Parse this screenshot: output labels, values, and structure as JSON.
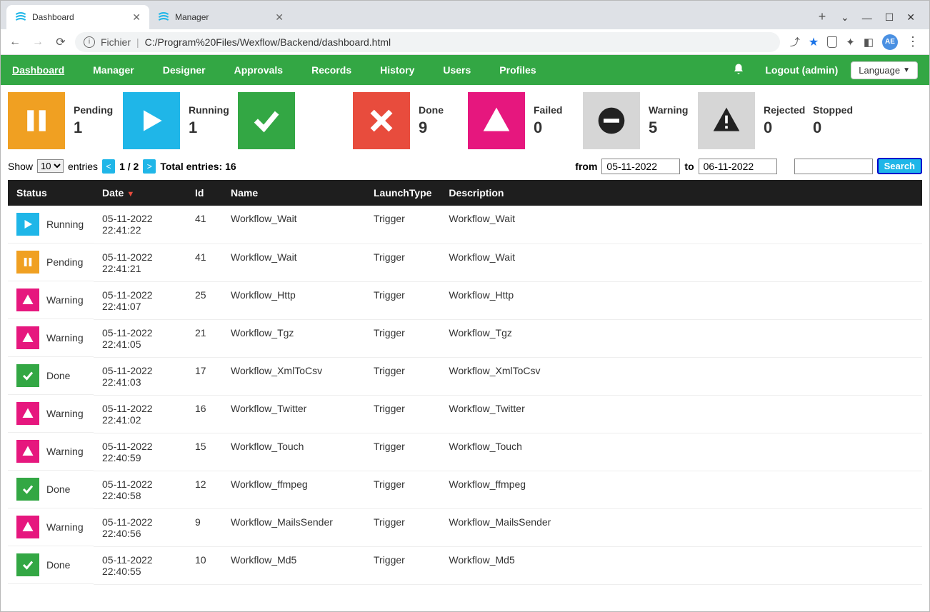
{
  "browser": {
    "tabs": [
      {
        "title": "Dashboard",
        "active": true
      },
      {
        "title": "Manager",
        "active": false
      }
    ],
    "addr": {
      "label": "Fichier",
      "url": "C:/Program%20Files/Wexflow/Backend/dashboard.html"
    },
    "avatar": "AE"
  },
  "nav": {
    "items": [
      "Dashboard",
      "Manager",
      "Designer",
      "Approvals",
      "Records",
      "History",
      "Users",
      "Profiles"
    ],
    "active": "Dashboard",
    "logout": "Logout (admin)",
    "language": "Language"
  },
  "tiles": [
    {
      "label": "Pending",
      "count": "1",
      "color": "c-orange",
      "icon": "pause"
    },
    {
      "label": "Running",
      "count": "1",
      "color": "c-blue",
      "icon": "play"
    },
    {
      "label": "",
      "count": "",
      "color": "c-green",
      "icon": "check"
    },
    {
      "label": "Done",
      "count": "9",
      "color": "c-red",
      "icon": "times"
    },
    {
      "label": "Failed",
      "count": "0",
      "color": "c-pink",
      "icon": "warn"
    },
    {
      "label": "Warning",
      "count": "5",
      "color": "c-grey",
      "icon": "minus"
    },
    {
      "label": "Rejected",
      "count": "0",
      "color": "c-grey",
      "icon": "excl"
    },
    {
      "label": "Stopped",
      "count": "0",
      "color": "",
      "icon": ""
    }
  ],
  "controls": {
    "show": "Show",
    "pagesize": "10",
    "entries": "entries",
    "page": "1 / 2",
    "total": "Total entries: 16",
    "from": "from",
    "from_val": "05-11-2022",
    "to": "to",
    "to_val": "06-11-2022",
    "search": "Search"
  },
  "table": {
    "headers": [
      "Status",
      "Date",
      "Id",
      "Name",
      "LaunchType",
      "Description"
    ],
    "rows": [
      {
        "status": "Running",
        "icon": "play",
        "color": "c-blue",
        "date": "05-11-2022 22:41:22",
        "id": "41",
        "name": "Workflow_Wait",
        "launch": "Trigger",
        "desc": "Workflow_Wait"
      },
      {
        "status": "Pending",
        "icon": "pause",
        "color": "c-orange",
        "date": "05-11-2022 22:41:21",
        "id": "41",
        "name": "Workflow_Wait",
        "launch": "Trigger",
        "desc": "Workflow_Wait"
      },
      {
        "status": "Warning",
        "icon": "warn",
        "color": "c-pink",
        "date": "05-11-2022 22:41:07",
        "id": "25",
        "name": "Workflow_Http",
        "launch": "Trigger",
        "desc": "Workflow_Http"
      },
      {
        "status": "Warning",
        "icon": "warn",
        "color": "c-pink",
        "date": "05-11-2022 22:41:05",
        "id": "21",
        "name": "Workflow_Tgz",
        "launch": "Trigger",
        "desc": "Workflow_Tgz"
      },
      {
        "status": "Done",
        "icon": "check",
        "color": "c-green",
        "date": "05-11-2022 22:41:03",
        "id": "17",
        "name": "Workflow_XmlToCsv",
        "launch": "Trigger",
        "desc": "Workflow_XmlToCsv"
      },
      {
        "status": "Warning",
        "icon": "warn",
        "color": "c-pink",
        "date": "05-11-2022 22:41:02",
        "id": "16",
        "name": "Workflow_Twitter",
        "launch": "Trigger",
        "desc": "Workflow_Twitter"
      },
      {
        "status": "Warning",
        "icon": "warn",
        "color": "c-pink",
        "date": "05-11-2022 22:40:59",
        "id": "15",
        "name": "Workflow_Touch",
        "launch": "Trigger",
        "desc": "Workflow_Touch"
      },
      {
        "status": "Done",
        "icon": "check",
        "color": "c-green",
        "date": "05-11-2022 22:40:58",
        "id": "12",
        "name": "Workflow_ffmpeg",
        "launch": "Trigger",
        "desc": "Workflow_ffmpeg"
      },
      {
        "status": "Warning",
        "icon": "warn",
        "color": "c-pink",
        "date": "05-11-2022 22:40:56",
        "id": "9",
        "name": "Workflow_MailsSender",
        "launch": "Trigger",
        "desc": "Workflow_MailsSender"
      },
      {
        "status": "Done",
        "icon": "check",
        "color": "c-green",
        "date": "05-11-2022 22:40:55",
        "id": "10",
        "name": "Workflow_Md5",
        "launch": "Trigger",
        "desc": "Workflow_Md5"
      }
    ]
  }
}
